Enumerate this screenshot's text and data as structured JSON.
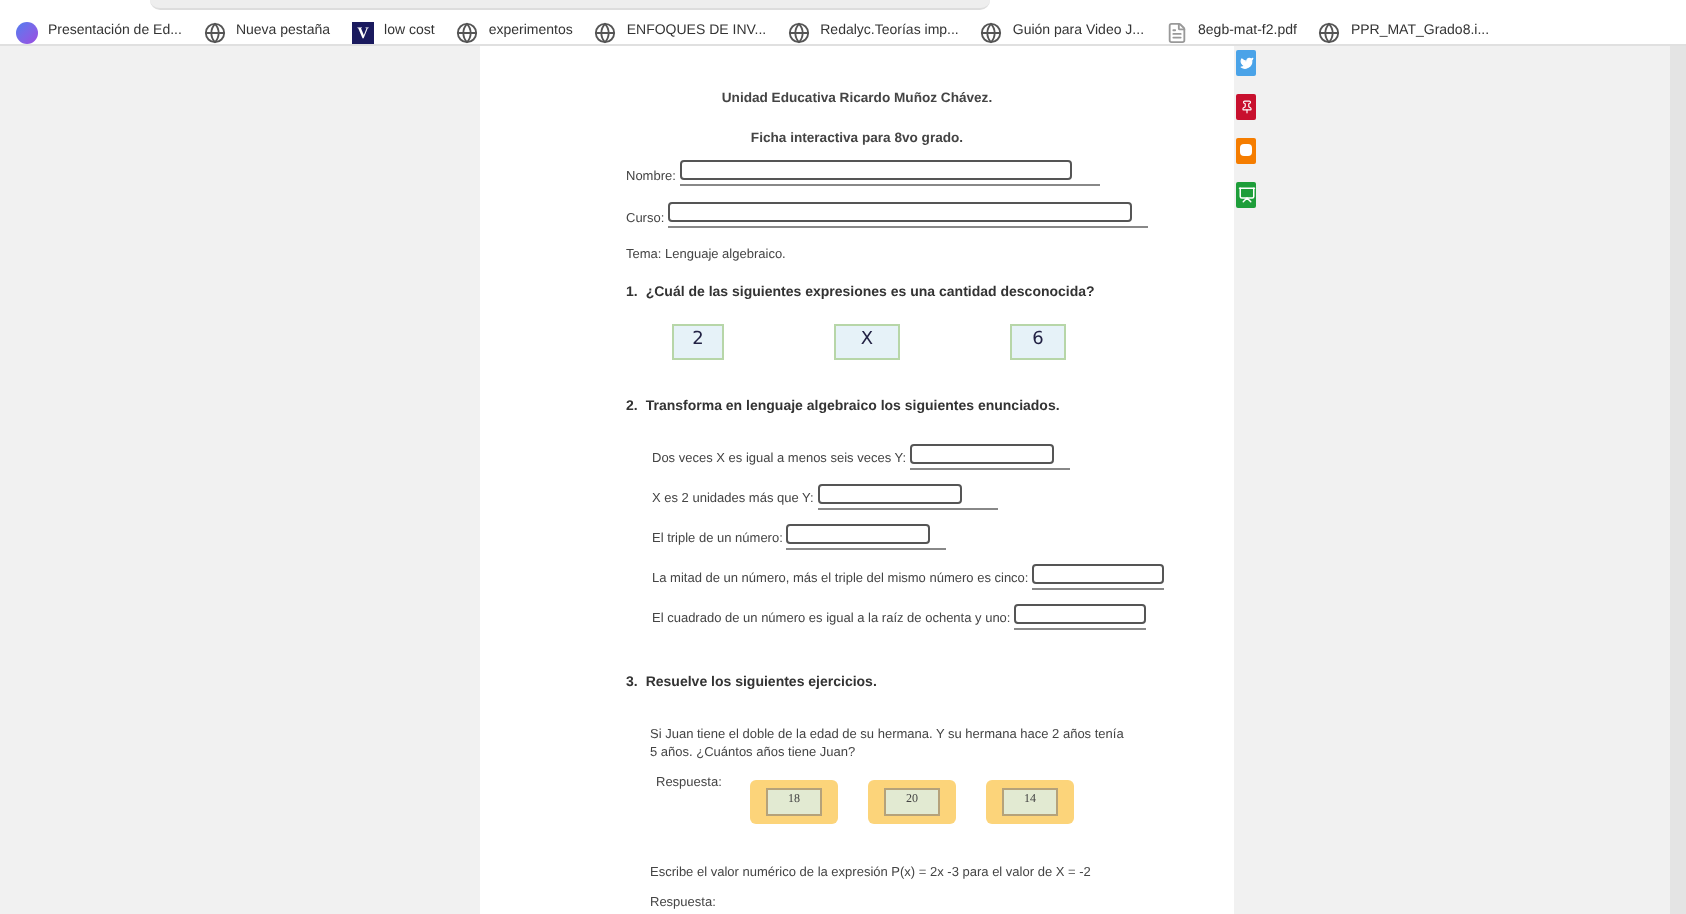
{
  "bookmarks": [
    {
      "label": "Presentación de Ed...",
      "kind": "app"
    },
    {
      "label": "Nueva pestaña",
      "kind": "globe"
    },
    {
      "label": "low cost",
      "kind": "letter",
      "letter": "V"
    },
    {
      "label": "experimentos",
      "kind": "globe"
    },
    {
      "label": "ENFOQUES DE INV...",
      "kind": "globe"
    },
    {
      "label": "Redalyc.Teorías imp...",
      "kind": "globe"
    },
    {
      "label": "Guión para Video J...",
      "kind": "globe"
    },
    {
      "label": "8egb-mat-f2.pdf",
      "kind": "file"
    },
    {
      "label": "PPR_MAT_Grado8.i...",
      "kind": "globe"
    }
  ],
  "share_buttons": [
    {
      "kind": "bird",
      "color": "#4aa3e8"
    },
    {
      "kind": "pin",
      "color": "#c8102e"
    },
    {
      "kind": "blog",
      "color": "#f57d00"
    },
    {
      "kind": "board",
      "color": "#1e9e3a"
    }
  ],
  "worksheet": {
    "title": "Unidad Educativa Ricardo Muñoz Chávez.",
    "subtitle": "Ficha interactiva para 8vo grado.",
    "fields": [
      {
        "label": "Nombre:"
      },
      {
        "label": "Curso:"
      }
    ],
    "topic": "Tema: Lenguaje algebraico.",
    "q1": {
      "number": "1.",
      "text": "¿Cuál de las siguientes expresiones es una cantidad desconocida?",
      "options": [
        "2",
        "X",
        "6"
      ]
    },
    "q2": {
      "number": "2.",
      "text": "Transforma en lenguaje algebraico los siguientes enunciados.",
      "items": [
        "Dos veces X es igual a menos seis veces Y:",
        "X es 2 unidades más que Y:",
        "El triple de un número:",
        "La mitad de un número, más el triple del mismo número es cinco:",
        "El cuadrado de un número es igual a la raíz de ochenta y uno:"
      ]
    },
    "q3": {
      "number": "3.",
      "text": "Resuelve los siguientes ejercicios.",
      "problem": "Si Juan tiene el doble de la edad de su hermana. Y su hermana hace 2 años tenía 5 años. ¿Cuántos años tiene Juan?",
      "answer_label": "Respuesta:",
      "answers": [
        "18",
        "20",
        "14"
      ],
      "problem_2": "Escribe el valor numérico de la expresión P(x) = 2x -3 para el valor de X = -2",
      "answer_label_2": "Respuesta:"
    }
  }
}
